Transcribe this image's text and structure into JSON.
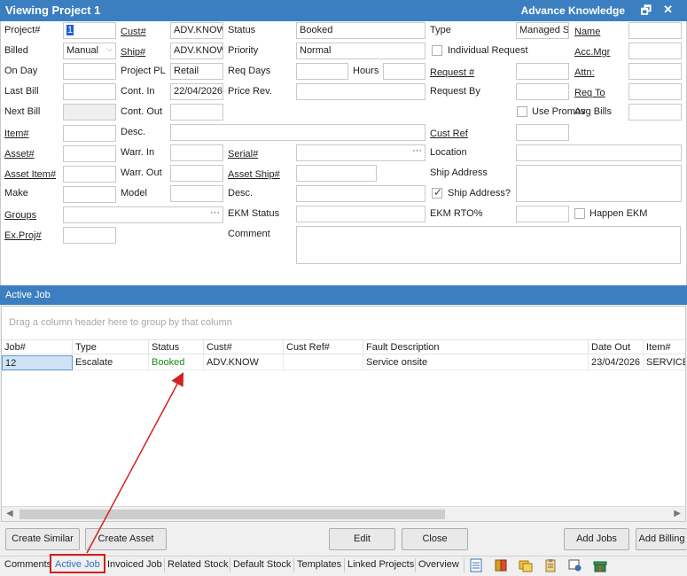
{
  "window": {
    "title": "Viewing Project 1",
    "company": "Advance Knowledge",
    "restore_glyph": "🗗",
    "close_glyph": "✕"
  },
  "form": {
    "project_no_label": "Project#",
    "project_no_value": "1",
    "billed_label": "Billed",
    "billed_value": "Manual",
    "on_day_label": "On Day",
    "last_bill_label": "Last Bill",
    "next_bill_label": "Next Bill",
    "item_label": "Item#",
    "asset_label": "Asset#",
    "asset_item_label": "Asset Item#",
    "make_label": "Make",
    "groups_label": "Groups",
    "ex_proj_label": "Ex.Proj#",
    "cust_label": "Cust#",
    "cust_value": "ADV.KNOW",
    "ship_label": "Ship#",
    "ship_value": "ADV.KNOW",
    "project_pl_label": "Project PL",
    "project_pl_value": "Retail",
    "cont_in_label": "Cont. In",
    "cont_in_value": "22/04/2026",
    "cont_out_label": "Cont. Out",
    "desc_label": "Desc.",
    "warr_in_label": "Warr. In",
    "warr_out_label": "Warr. Out",
    "model_label": "Model",
    "status_label": "Status",
    "status_value": "Booked",
    "priority_label": "Priority",
    "priority_value": "Normal",
    "req_days_label": "Req Days",
    "hours_label": "Hours",
    "price_rev_label": "Price Rev.",
    "serial_label": "Serial#",
    "asset_ship_label": "Asset Ship#",
    "desc2_label": "Desc.",
    "ekm_status_label": "EKM Status",
    "comment_label": "Comment",
    "type_label": "Type",
    "type_value": "Managed Se",
    "individual_request_label": "Individual Request",
    "request_no_label": "Request #",
    "request_by_label": "Request By",
    "use_promos_label": "Use Promos",
    "cust_ref_label": "Cust Ref",
    "location_label": "Location",
    "ship_address_label": "Ship Address",
    "ship_address_chk_label": "Ship Address?",
    "ekm_rto_label": "EKM RTO%",
    "happen_ekm_label": "Happen EKM",
    "name_label": "Name",
    "acc_mgr_label": "Acc.Mgr",
    "attn_label": "Attn:",
    "req_to_label": "Req To",
    "avg_bills_label": "Avg Bills",
    "ellipsis": "···",
    "dropdown_glyph": "⌵"
  },
  "active_job": {
    "section_title": "Active Job",
    "group_hint": "Drag a column header here to group by that column",
    "columns": [
      "Job#",
      "Type",
      "Status",
      "Cust#",
      "Cust Ref#",
      "Fault Description",
      "Date Out",
      "Item#"
    ],
    "rows": [
      {
        "job": "12",
        "type": "Escalate",
        "status": "Booked",
        "cust": "ADV.KNOW",
        "cust_ref": "",
        "fault": "Service onsite",
        "date_out": "23/04/2026",
        "item": "SERVICE"
      }
    ],
    "status_color": "#1a8a1a"
  },
  "buttons": {
    "create_similar": "Create Similar",
    "create_asset": "Create Asset",
    "edit": "Edit",
    "close": "Close",
    "add_jobs": "Add Jobs",
    "add_billing": "Add Billing"
  },
  "tabs": {
    "comments": "Comments",
    "active_job": "Active Job",
    "invoiced_job": "Invoiced Job",
    "related_stock": "Related Stock",
    "default_stock": "Default Stock",
    "templates": "Templates",
    "linked_projects": "Linked Projects",
    "overview": "Overview"
  },
  "colors": {
    "title_bar": "#3c7fc1",
    "annotation_red": "#d32020",
    "active_tab": "#2a6fc4"
  }
}
